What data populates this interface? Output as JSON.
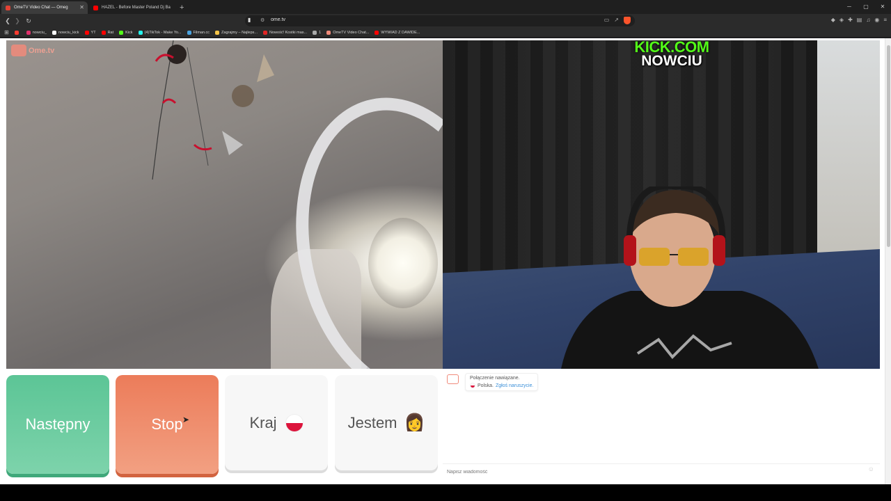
{
  "browser": {
    "tabs": [
      {
        "title": "OmeTV Video Chat — Omeg",
        "active": true,
        "color": "#e34234"
      },
      {
        "title": "HAZEL - Before Master Poland Dj Ba",
        "active": false,
        "color": "#ff0000"
      }
    ],
    "new_tab": "+",
    "url": "ome.tv",
    "bookmarks": [
      {
        "label": "",
        "color": "#ff3b30"
      },
      {
        "label": "nowciu_",
        "color": "#e1306c"
      },
      {
        "label": "nowciu_kick",
        "color": "#ffffff"
      },
      {
        "label": "YT",
        "color": "#ff0000"
      },
      {
        "label": "Rat",
        "color": "#ff0000"
      },
      {
        "label": "Kick",
        "color": "#53fc18"
      },
      {
        "label": "(4)TikTok - Make Yo...",
        "color": "#25f4ee"
      },
      {
        "label": "Filman.cc",
        "color": "#4aa3df"
      },
      {
        "label": "Zagrajmy – Najleps...",
        "color": "#f7c548"
      },
      {
        "label": "Nowość! Kostki mas...",
        "color": "#e02424"
      },
      {
        "label": "1",
        "color": "#aaaaaa"
      },
      {
        "label": "OmeTV Video Chat...",
        "color": "#f08a7a"
      },
      {
        "label": "WYWIAD Z DAWIDE...",
        "color": "#ff0000"
      }
    ]
  },
  "site": {
    "logo_text": "Ome.tv"
  },
  "stream_overlay": {
    "line1": "KICK.COM",
    "line2": "NOWCIU"
  },
  "controls": {
    "next_label": "Następny",
    "stop_label": "Stop",
    "country_label": "Kraj",
    "gender_label": "Jestem",
    "gender_emoji": "👩"
  },
  "chat": {
    "connected": "Połączenie nawiązane.",
    "country": "Polska.",
    "report": "Zgłoś naruszycie.",
    "input_placeholder": "Napisz wiadomość"
  }
}
